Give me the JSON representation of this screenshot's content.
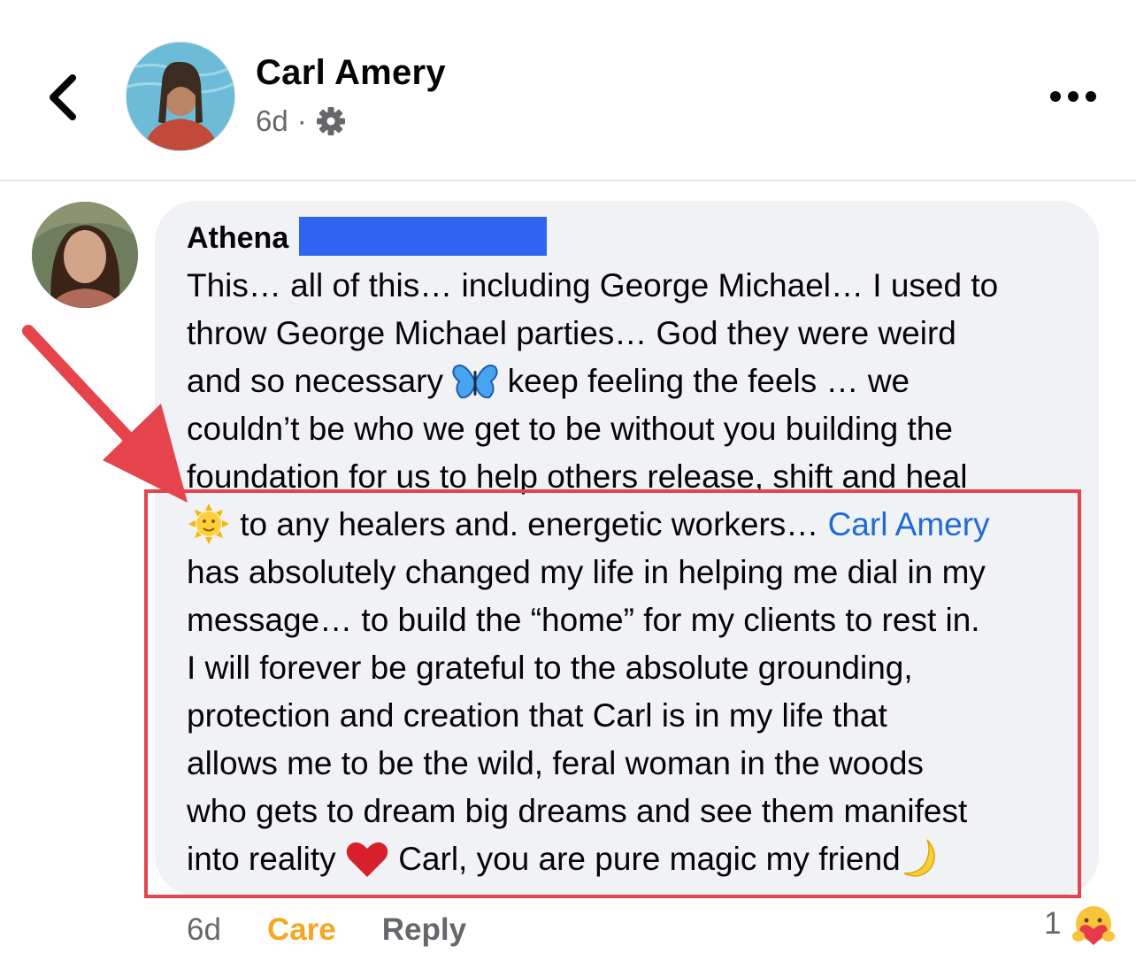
{
  "header": {
    "name": "Carl Amery",
    "time": "6d",
    "separator": "·"
  },
  "comment": {
    "author_first_name": "Athena",
    "lines": [
      "This… all of this… including George Michael… I used to",
      "throw George Michael parties… God they were weird",
      "and so necessary",
      "keep feeling the feels … we",
      "couldn’t be who we get to be without you building the",
      "foundation for us to help others release, shift and heal",
      "to any healers and. energetic workers…",
      "Carl Amery",
      "has absolutely changed my life in helping me dial in my",
      "message… to build the “home” for my clients to rest in.",
      "I will forever be grateful to the absolute grounding,",
      "protection and creation that Carl is in my life that",
      "allows me to be the wild, feral woman in the woods",
      "who gets to dream big dreams and see them manifest",
      "into reality",
      "Carl, you are pure magic my friend"
    ],
    "mention": "Carl Amery"
  },
  "actions": {
    "time": "6d",
    "care_label": "Care",
    "reply_label": "Reply",
    "reaction_count": "1"
  },
  "icons": {
    "back": "chevron-left-icon",
    "gear": "gear-icon",
    "more": "more-dots-icon",
    "butterfly": "butterfly-emoji",
    "sun": "sun-face-emoji",
    "heart": "red-heart-emoji",
    "moon": "crescent-moon-emoji",
    "care": "care-reaction-icon"
  },
  "colors": {
    "mention": "#1d6ad8",
    "care": "#f5a623",
    "annotation": "#e5444d",
    "redaction": "#2e64f0",
    "bubble": "#f0f2f5"
  }
}
